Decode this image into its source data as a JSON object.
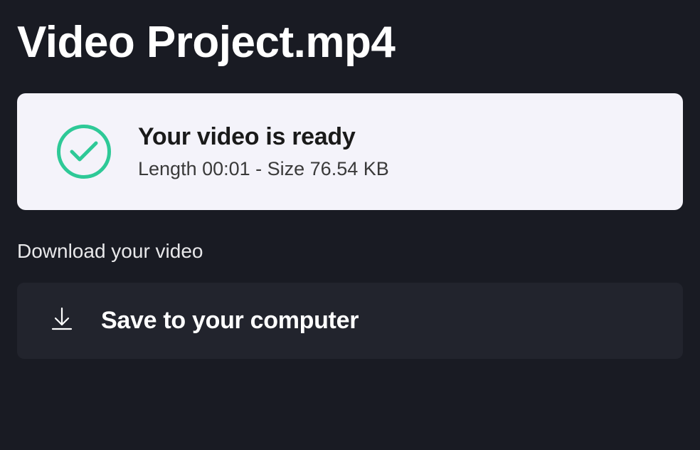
{
  "header": {
    "title": "Video Project.mp4"
  },
  "status": {
    "heading": "Your video is ready",
    "details": "Length 00:01 - Size 76.54 KB"
  },
  "download": {
    "section_heading": "Download your video",
    "save_label": "Save to your computer"
  }
}
